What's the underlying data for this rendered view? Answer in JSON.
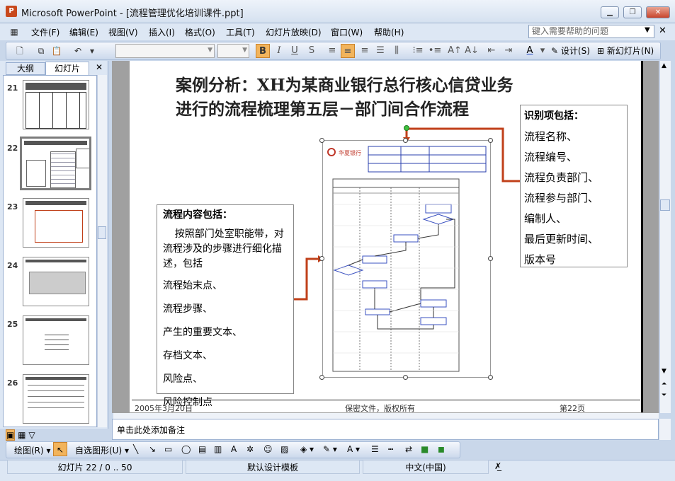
{
  "window": {
    "title": "Microsoft PowerPoint - [流程管理优化培训课件.ppt]",
    "app_icon": "powerpoint-icon",
    "controls": [
      "minimize-icon",
      "restore-icon",
      "close-icon"
    ]
  },
  "menu": {
    "items": [
      "文件(F)",
      "编辑(E)",
      "视图(V)",
      "插入(I)",
      "格式(O)",
      "工具(T)",
      "幻灯片放映(D)",
      "窗口(W)",
      "帮助(H)"
    ],
    "help_placeholder": "键入需要帮助的问题"
  },
  "toolbar": {
    "design_label": "设计(S)",
    "new_slide_label": "新幻灯片(N)",
    "bold": "B",
    "italic": "I",
    "underline": "U",
    "shadow": "S"
  },
  "left_panel": {
    "tabs": [
      "大纲",
      "幻灯片"
    ],
    "active_tab": "幻灯片",
    "slide_numbers": [
      "21",
      "22",
      "23",
      "24",
      "25",
      "26"
    ],
    "selected_slide": "22"
  },
  "slide": {
    "title_line1": "案例分析：XH为某商业银行总行核心信贷业务",
    "title_line2": "进行的流程梳理第五层－部门间合作流程",
    "right_box": [
      "识别项包括：",
      "流程名称、",
      "流程编号、",
      "流程负责部门、",
      "流程参与部门、",
      "编制人、",
      "最后更新时间、",
      "版本号"
    ],
    "left_box": {
      "heading": "流程内容包括：",
      "intro": "按照部门处室职能带，对流程涉及的步骤进行细化描述，包括",
      "items": [
        "流程始末点、",
        "流程步骤、",
        "产生的重要文本、",
        "存档文本、",
        "风险点、",
        "风险控制点"
      ]
    },
    "flowchart_logo": "华夏银行",
    "footer_date": "2005年3月20日",
    "footer_center": "保密文件，版权所有",
    "footer_page": "第22页"
  },
  "notes_placeholder": "单击此处添加备注",
  "drawing_toolbar": {
    "draw_label": "绘图(R)",
    "autoshape_label": "自选图形(U)"
  },
  "status": {
    "slide_info": "幻灯片 22 / 0 .. 50",
    "template": "默认设计模板",
    "language": "中文(中国)"
  },
  "colors": {
    "accent_orange": "#f2b45c",
    "arrow_red": "#c0401a",
    "chrome_blue": "#dde7f4"
  }
}
